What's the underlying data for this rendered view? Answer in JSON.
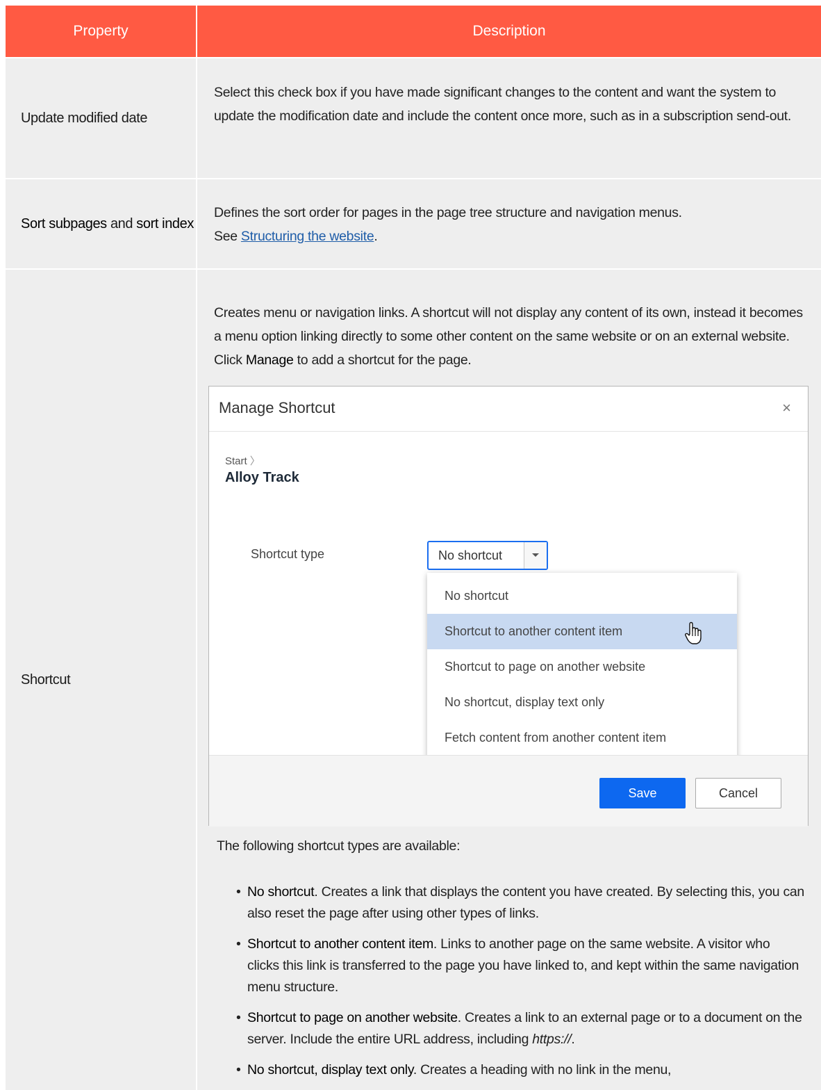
{
  "table": {
    "headers": {
      "property": "Property",
      "description": "Description"
    },
    "rows": {
      "update": {
        "property": "Update modified date",
        "description": "Select this check box if you have made significant changes to the content and want the system to update the modification date and include the content once more, such as in a subscription send-out."
      },
      "sort": {
        "property_a": "Sort subpages",
        "property_and": " and ",
        "property_b": "sort index",
        "description": "Defines the sort order for pages in the page tree structure and navigation menus.",
        "see_prefix": "See ",
        "see_link": "Structuring the website",
        "see_suffix": "."
      },
      "shortcut": {
        "property": "Shortcut",
        "intro_a": "Creates menu or navigation links. A shortcut will not display any content of its own, instead it becomes a menu option linking directly to some other content on the same website or on an external website. Click ",
        "intro_b": "Manage",
        "intro_c": " to add a shortcut for the page.",
        "types_intro": "The following shortcut types are available:",
        "items": [
          {
            "term": "No shortcut",
            "text": ". Creates a link that displays the content you have created. By selecting this, you can also reset the page after using other types of links."
          },
          {
            "term": "Shortcut to another content item",
            "text": ". Links to another page on the same website. A visitor who clicks this link is transferred to the page you have linked to, and kept within the same navigation menu structure."
          },
          {
            "term": "Shortcut to page on another website",
            "text": ". Creates a link to an external page or to a document on the server. Include the entire URL address, including ",
            "em": "https://",
            "end": "."
          },
          {
            "term": "No shortcut, display text only",
            "text": ". Creates a heading with no link in the menu,"
          }
        ]
      }
    }
  },
  "dialog": {
    "title": "Manage Shortcut",
    "close": "×",
    "breadcrumb": "Start",
    "breadcrumb_sep": "〉",
    "page_name": "Alloy Track",
    "shortcut_label": "Shortcut type",
    "selected": "No shortcut",
    "options": [
      "No shortcut",
      "Shortcut to another content item",
      "Shortcut to page on another website",
      "No shortcut, display text only",
      "Fetch content from another content item"
    ],
    "save": "Save",
    "cancel": "Cancel"
  },
  "colors": {
    "header": "#ff5a43",
    "accent": "#0d68f0",
    "highlight": "#c8d9f1",
    "link": "#1f5da8"
  }
}
